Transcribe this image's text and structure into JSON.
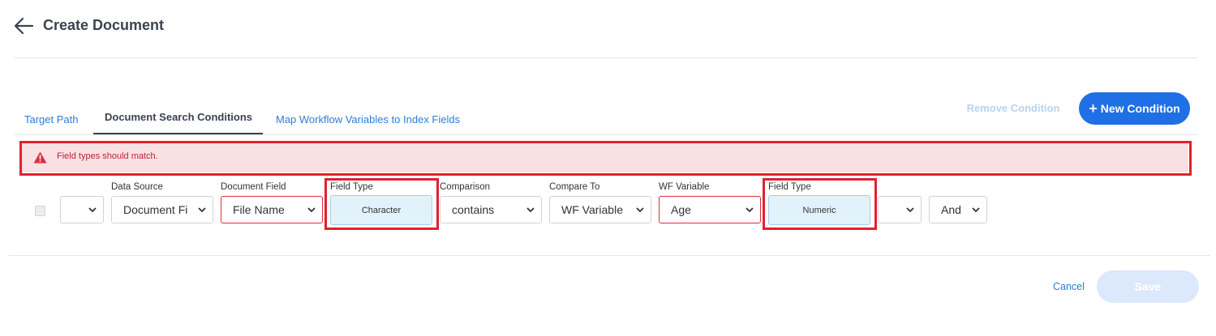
{
  "header": {
    "title": "Create Document",
    "back_icon": "arrow-left-icon"
  },
  "tabs": [
    {
      "label": "Target Path",
      "active": false
    },
    {
      "label": "Document Search Conditions",
      "active": true
    },
    {
      "label": "Map Workflow Variables to Index Fields",
      "active": false
    }
  ],
  "actions": {
    "remove_label": "Remove Condition",
    "new_label": "New Condition"
  },
  "alert": {
    "icon": "warning-triangle-icon",
    "message": "Field types should match."
  },
  "condition_row": {
    "selected": false,
    "paren_open": "",
    "data_source": {
      "label": "Data Source",
      "value": "Document Fi"
    },
    "document_field": {
      "label": "Document Field",
      "value": "File Name"
    },
    "field_type_left": {
      "label": "Field Type",
      "value": "Character"
    },
    "comparison": {
      "label": "Comparison",
      "value": "contains"
    },
    "compare_to": {
      "label": "Compare To",
      "value": "WF Variable"
    },
    "wf_variable": {
      "label": "WF Variable",
      "value": "Age"
    },
    "field_type_right": {
      "label": "Field Type",
      "value": "Numeric"
    },
    "paren_close": "",
    "logic": "And"
  },
  "footer": {
    "cancel_label": "Cancel",
    "save_label": "Save"
  },
  "colors": {
    "accent": "#1f6fe5",
    "error": "#e2202f",
    "alert_bg": "#f9e1e3",
    "field_type_bg": "#e2f2fb"
  }
}
